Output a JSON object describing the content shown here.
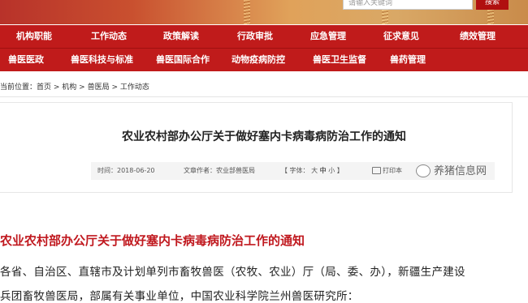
{
  "search": {
    "placeholder": "请输入关键词",
    "button_label": "搜索"
  },
  "nav_primary": [
    "机构职能",
    "工作动态",
    "政策解读",
    "行政审批",
    "应急管理",
    "征求意见",
    "绩效管理"
  ],
  "nav_secondary": [
    "兽医医政",
    "兽医科技与标准",
    "兽医国际合作",
    "动物疫病防控",
    "兽医卫生监督",
    "兽药管理"
  ],
  "breadcrumb": {
    "prefix": "当前位置：",
    "items": [
      "首页",
      "机构",
      "兽医局",
      "工作动态"
    ],
    "separator": " > "
  },
  "article": {
    "title": "农业农村部办公厅关于做好塞内卡病毒病防治工作的通知",
    "time_label": "时间：",
    "time_value": "2018-06-20",
    "author_label": "文章作者：",
    "author_value": "农业部兽医局",
    "font_label": "【 字体：",
    "font_large": "大",
    "font_medium": "中",
    "font_small": "小",
    "font_close": "】",
    "print_label": "打印本",
    "watermark": "养猪信息网"
  },
  "body": {
    "heading": "农业农村部办公厅关于做好塞内卡病毒病防治工作的通知",
    "line1": "各省、自治区、直辖市及计划单列市畜牧兽医（农牧、农业）厅（局、委、办），新疆生产建设",
    "line2": "兵团畜牧兽医局，部属有关事业单位，中国农业科学院兰州兽医研究所："
  },
  "colors": {
    "nav_bg": "#c01b1b",
    "heading_red": "#c0181e"
  }
}
